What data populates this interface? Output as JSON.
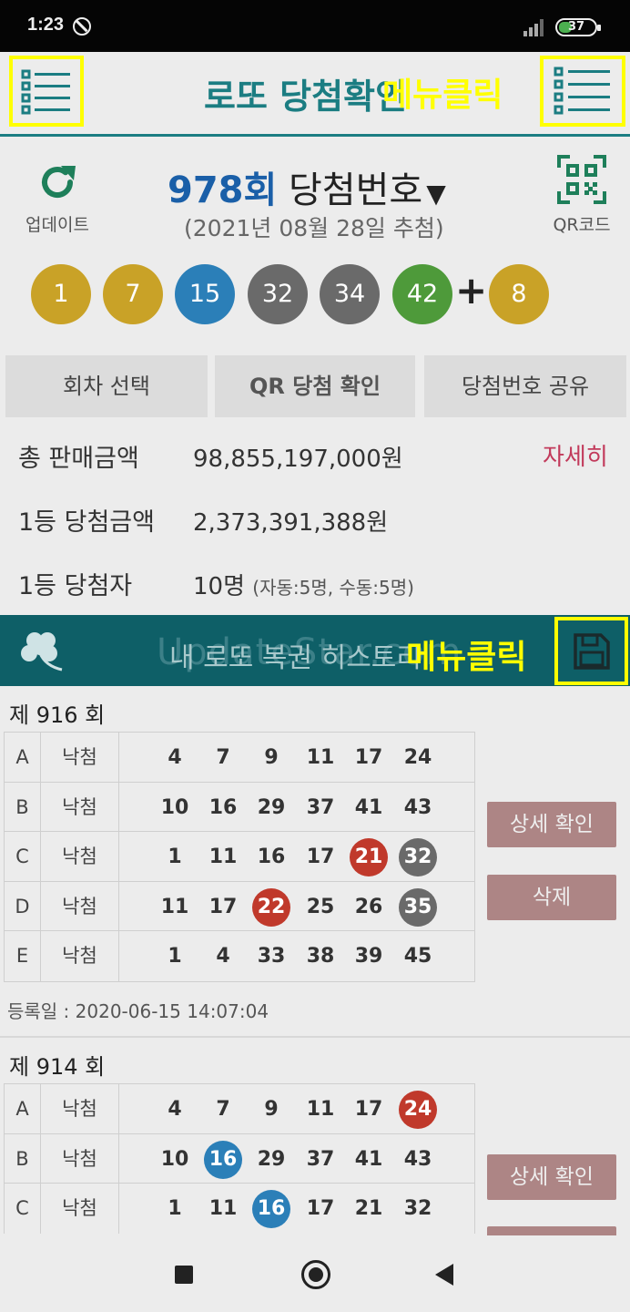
{
  "status_bar": {
    "time": "1:23",
    "battery": "37"
  },
  "header": {
    "title": "로또 당첨확인",
    "menu_click_label": "메뉴클릭"
  },
  "draw": {
    "update_label": "업데이트",
    "qr_label": "QR코드",
    "round_number": "978회",
    "round_text": "당첨번호",
    "dropdown_arrow": "▼",
    "date": "(2021년 08월 28일 추첨)",
    "balls": [
      {
        "n": "1",
        "color": "#c9a227"
      },
      {
        "n": "7",
        "color": "#c9a227"
      },
      {
        "n": "15",
        "color": "#2b7fb8"
      },
      {
        "n": "32",
        "color": "#6a6a6a"
      },
      {
        "n": "34",
        "color": "#6a6a6a"
      },
      {
        "n": "42",
        "color": "#4e9a3a"
      }
    ],
    "plus": "+",
    "bonus": {
      "n": "8",
      "color": "#c9a227"
    }
  },
  "actions": {
    "select_round": "회차 선택",
    "qr_check": "QR 당첨 확인",
    "share": "당첨번호 공유"
  },
  "info": {
    "total_sales_label": "총 판매금액",
    "total_sales_value": "98,855,197,000원",
    "detail_link": "자세히",
    "first_prize_label": "1등 당첨금액",
    "first_prize_value": "2,373,391,388원",
    "first_winners_label": "1등 당첨자",
    "first_winners_value": "10명",
    "first_winners_detail": "(자동:5명, 수동:5명)"
  },
  "history": {
    "title": "내 로또 복권 히스토리",
    "watermark": "UpdateStar.com",
    "menu_click_label": "메뉴클릭"
  },
  "tickets": [
    {
      "title": "제 916 회",
      "rows": [
        {
          "letter": "A",
          "result": "낙첨",
          "nums": [
            {
              "v": "4"
            },
            {
              "v": "7"
            },
            {
              "v": "9"
            },
            {
              "v": "11"
            },
            {
              "v": "17"
            },
            {
              "v": "24"
            }
          ]
        },
        {
          "letter": "B",
          "result": "낙첨",
          "nums": [
            {
              "v": "10"
            },
            {
              "v": "16"
            },
            {
              "v": "29"
            },
            {
              "v": "37"
            },
            {
              "v": "41"
            },
            {
              "v": "43"
            }
          ]
        },
        {
          "letter": "C",
          "result": "낙첨",
          "nums": [
            {
              "v": "1"
            },
            {
              "v": "11"
            },
            {
              "v": "16"
            },
            {
              "v": "17"
            },
            {
              "v": "21",
              "hit": "#c0392b"
            },
            {
              "v": "32",
              "hit": "#6a6a6a"
            }
          ]
        },
        {
          "letter": "D",
          "result": "낙첨",
          "nums": [
            {
              "v": "11"
            },
            {
              "v": "17"
            },
            {
              "v": "22",
              "hit": "#c0392b"
            },
            {
              "v": "25"
            },
            {
              "v": "26"
            },
            {
              "v": "35",
              "hit": "#6a6a6a"
            }
          ]
        },
        {
          "letter": "E",
          "result": "낙첨",
          "nums": [
            {
              "v": "1"
            },
            {
              "v": "4"
            },
            {
              "v": "33"
            },
            {
              "v": "38"
            },
            {
              "v": "39"
            },
            {
              "v": "45"
            }
          ]
        }
      ],
      "reg_date": "등록일 : 2020-06-15 14:07:04",
      "detail_button": "상세 확인",
      "delete_button": "삭제"
    },
    {
      "title": "제 914 회",
      "rows": [
        {
          "letter": "A",
          "result": "낙첨",
          "nums": [
            {
              "v": "4"
            },
            {
              "v": "7"
            },
            {
              "v": "9"
            },
            {
              "v": "11"
            },
            {
              "v": "17"
            },
            {
              "v": "24",
              "hit": "#c0392b"
            }
          ]
        },
        {
          "letter": "B",
          "result": "낙첨",
          "nums": [
            {
              "v": "10"
            },
            {
              "v": "16",
              "hit": "#2b7fb8"
            },
            {
              "v": "29"
            },
            {
              "v": "37"
            },
            {
              "v": "41"
            },
            {
              "v": "43"
            }
          ]
        },
        {
          "letter": "C",
          "result": "낙첨",
          "nums": [
            {
              "v": "1"
            },
            {
              "v": "11"
            },
            {
              "v": "16",
              "hit": "#2b7fb8"
            },
            {
              "v": "17"
            },
            {
              "v": "21"
            },
            {
              "v": "32"
            }
          ]
        }
      ],
      "detail_button": "상세 확인"
    }
  ]
}
